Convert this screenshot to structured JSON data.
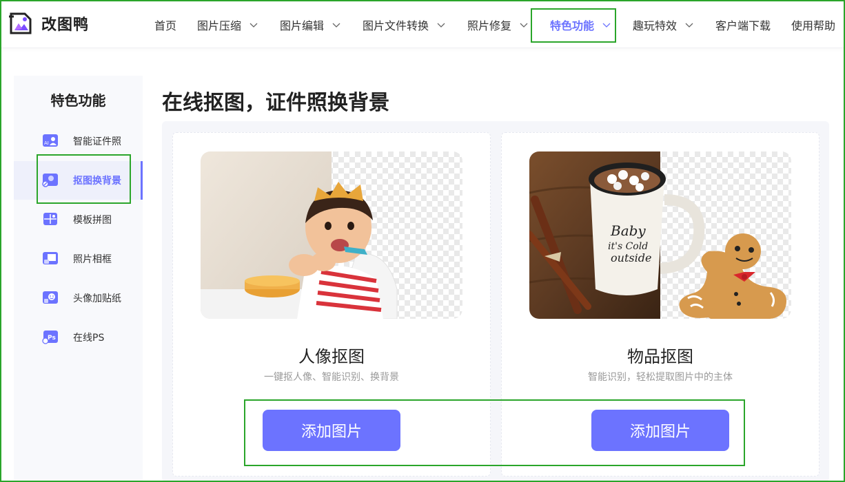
{
  "app": {
    "name": "改图鸭"
  },
  "nav": {
    "items": [
      {
        "label": "首页",
        "dropdown": false
      },
      {
        "label": "图片压缩",
        "dropdown": true
      },
      {
        "label": "图片编辑",
        "dropdown": true
      },
      {
        "label": "图片文件转换",
        "dropdown": true
      },
      {
        "label": "照片修复",
        "dropdown": true
      },
      {
        "label": "特色功能",
        "dropdown": true,
        "active": true
      },
      {
        "label": "趣玩特效",
        "dropdown": true
      },
      {
        "label": "客户端下载",
        "dropdown": false
      },
      {
        "label": "使用帮助",
        "dropdown": false
      }
    ]
  },
  "sidebar": {
    "title": "特色功能",
    "items": [
      {
        "label": "智能证件照",
        "icon": "id-photo-icon"
      },
      {
        "label": "抠图换背景",
        "icon": "cutout-icon",
        "active": true
      },
      {
        "label": "模板拼图",
        "icon": "puzzle-icon"
      },
      {
        "label": "照片相框",
        "icon": "photo-frame-icon"
      },
      {
        "label": "头像加贴纸",
        "icon": "sticker-icon"
      },
      {
        "label": "在线PS",
        "icon": "ps-icon",
        "icon_text": "Ps"
      }
    ]
  },
  "main": {
    "title": "在线抠图，证件照换背景",
    "cards": [
      {
        "name": "人像抠图",
        "desc": "一键抠人像、智能识别、换背景",
        "button": "添加图片"
      },
      {
        "name": "物品抠图",
        "desc": "智能识别，轻松提取图片中的主体",
        "button": "添加图片"
      }
    ],
    "mug_text": [
      "Baby",
      "it's Cold",
      "outside"
    ]
  },
  "colors": {
    "accent": "#6c73ff",
    "highlight_box": "#2aa52a"
  }
}
